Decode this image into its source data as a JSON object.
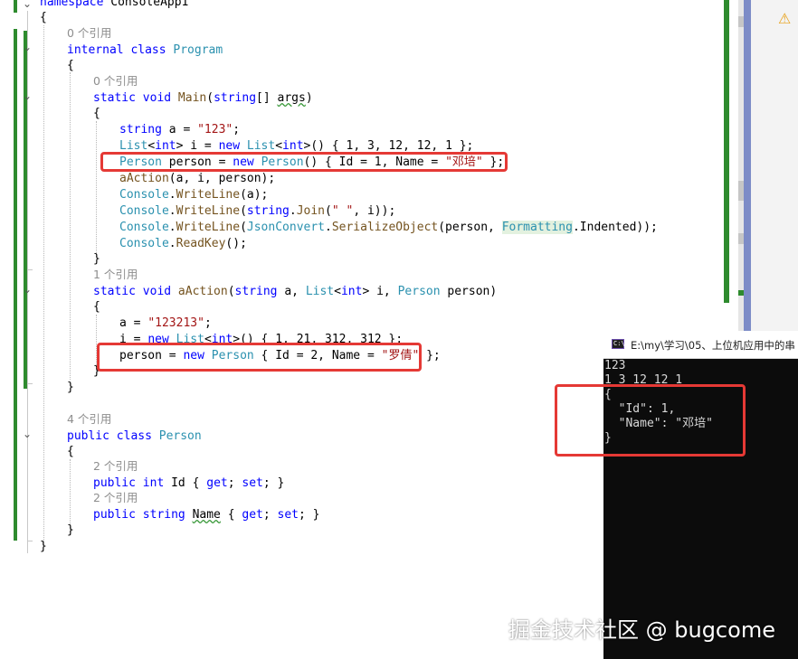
{
  "code": {
    "namespace_line": {
      "kw": "namespace",
      "name": " ConsoleApp1"
    },
    "brace_open": "{",
    "brace_close": "}",
    "ref0": "0 个引用",
    "ref1": "1 个引用",
    "ref2": "2 个引用",
    "ref4": "4 个引用",
    "class_program": {
      "kw": "internal class",
      "name": "Program"
    },
    "main_sig": {
      "kw": "static void",
      "meth": " Main",
      "p1": "(",
      "ty": "string",
      "p2": "[] ",
      "arg": "args",
      "p3": ")"
    },
    "l_string_a": {
      "kw": "string",
      "rest": " a = ",
      "str": "\"123\"",
      "end": ";"
    },
    "l_list": {
      "ty1": "List",
      "p1": "<",
      "kw1": "int",
      "p2": "> i = ",
      "kw2": "new",
      "sp": " ",
      "ty2": "List",
      "p3": "<",
      "kw3": "int",
      "p4": ">() { 1, 3, 12, 12, 1 };"
    },
    "l_person": {
      "ty1": "Person",
      "p1": " person = ",
      "kw": "new",
      "sp": " ",
      "ty2": "Person",
      "p2": "() { Id = 1, Name = ",
      "str": "\"邓培\"",
      "end": " };"
    },
    "l_aaction_call": {
      "meth": "aAction",
      "rest": "(a, i, person);"
    },
    "l_wl1": {
      "ty": "Console",
      "dot": ".",
      "meth": "WriteLine",
      "rest": "(a);"
    },
    "l_wl2": {
      "ty": "Console",
      "dot": ".",
      "meth": "WriteLine",
      "p1": "(",
      "kw": "string",
      "dot2": ".",
      "meth2": "Join",
      "p2": "(",
      "str": "\" \"",
      "p3": ", i));"
    },
    "l_wl3": {
      "ty": "Console",
      "dot": ".",
      "meth": "WriteLine",
      "p1": "(",
      "ty2": "JsonConvert",
      "dot2": ".",
      "meth2": "SerializeObject",
      "p2": "(person, ",
      "ty3": "Formatting",
      "p3": ".Indented));"
    },
    "l_readkey": {
      "ty": "Console",
      "dot": ".",
      "meth": "ReadKey",
      "rest": "();"
    },
    "aaction_sig": {
      "kw": "static void",
      "meth": " aAction",
      "p1": "(",
      "kw2": "string",
      "p2": " a, ",
      "ty": "List",
      "p3": "<",
      "kw3": "int",
      "p4": "> i, ",
      "ty2": "Person",
      "p5": " person)"
    },
    "l_a_assign": {
      "rest": "a = ",
      "str": "\"123213\"",
      "end": ";"
    },
    "l_i_assign": {
      "rest": "i = ",
      "kw": "new",
      "sp": " ",
      "ty": "List",
      "p1": "<",
      "kw2": "int",
      "p2": ">() { 1, 21, 312, 312 };"
    },
    "l_person_assign": {
      "rest": "person = ",
      "kw": "new",
      "sp": " ",
      "ty": "Person",
      "p1": " { Id = 2, Name = ",
      "str": "\"罗倩\"",
      "end": " };"
    },
    "class_person": {
      "kw": "public class",
      "name": "Person"
    },
    "prop_id": {
      "kw": "public int",
      "rest": " Id { ",
      "kw2": "get",
      "p1": "; ",
      "kw3": "set",
      "p2": "; }"
    },
    "prop_name": {
      "kw": "public string",
      "sp": " ",
      "name": "Name",
      "p0": " { ",
      "kw2": "get",
      "p1": "; ",
      "kw3": "set",
      "p2": "; }"
    }
  },
  "console": {
    "title": "E:\\my\\学习\\05、上位机应用中的串",
    "icon_label": "C:\\",
    "lines": [
      "123",
      "1 3 12 12 1",
      "{",
      "  \"Id\": 1,",
      "  \"Name\": \"邓培\"",
      "}"
    ]
  },
  "watermark": "掘金技术社区 @ bugcome",
  "icons": {
    "warning": "warning-icon",
    "fold": "chevron-down-icon",
    "console": "console-icon"
  },
  "colors": {
    "keyword": "#0000ff",
    "type": "#2b91af",
    "string": "#a31515",
    "method": "#74531f",
    "highlight": "#e53935",
    "change_bar": "#2e8b2e"
  }
}
